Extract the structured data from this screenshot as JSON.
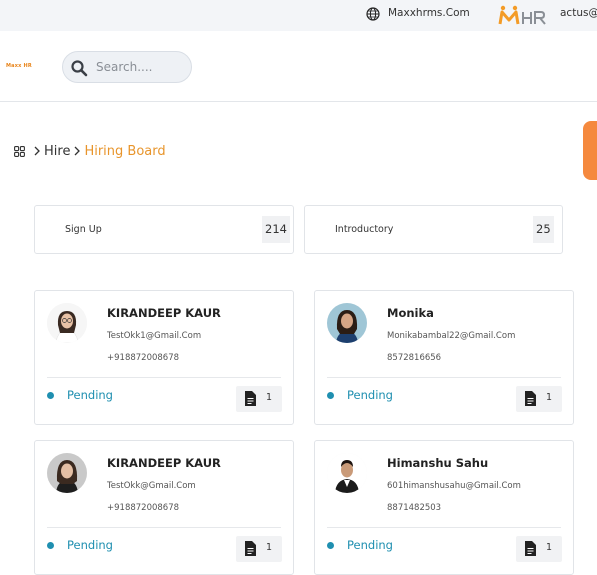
{
  "topbar": {
    "site": "Maxxhrms.Com",
    "logo_text": "MHR",
    "user": "actus@"
  },
  "header": {
    "brand": "Maxx HR",
    "search_placeholder": "Search...."
  },
  "breadcrumb": {
    "hire": "Hire",
    "board": "Hiring Board"
  },
  "stats": [
    {
      "label": "Sign Up",
      "count": "214"
    },
    {
      "label": "Introductory",
      "count": "25"
    }
  ],
  "candidates": [
    {
      "name": "KIRANDEEP KAUR",
      "email": "TestOkk1@Gmail.Com",
      "phone": "+918872008678",
      "status": "Pending",
      "docs": "1"
    },
    {
      "name": "Monika",
      "email": "Monikabambal22@Gmail.Com",
      "phone": "8572816656",
      "status": "Pending",
      "docs": "1"
    },
    {
      "name": "KIRANDEEP KAUR",
      "email": "TestOkk@Gmail.Com",
      "phone": "+918872008678",
      "status": "Pending",
      "docs": "1"
    },
    {
      "name": "Himanshu Sahu",
      "email": "601himanshusahu@Gmail.Com",
      "phone": "8871482503",
      "status": "Pending",
      "docs": "1"
    }
  ],
  "colors": {
    "accent_orange": "#e8952c",
    "status_teal": "#1f8fb0",
    "side_tab": "#f5893e"
  }
}
